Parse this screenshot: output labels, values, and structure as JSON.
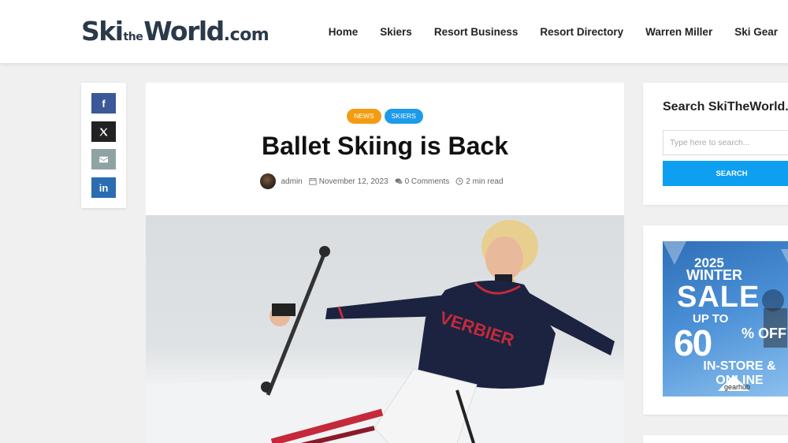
{
  "logo": {
    "part1": "Ski",
    "part2": "the",
    "part3": "World",
    "part4": ".com"
  },
  "nav": [
    "Home",
    "Skiers",
    "Resort Business",
    "Resort Directory",
    "Warren Miller",
    "Ski Gear"
  ],
  "share": [
    {
      "name": "facebook",
      "glyph": "f",
      "color": "#3b5998"
    },
    {
      "name": "x",
      "glyph": "𝕏",
      "color": "#222222"
    },
    {
      "name": "email",
      "glyph": "✉",
      "color": "#8fa3a3"
    },
    {
      "name": "linkedin",
      "glyph": "in",
      "color": "#2a6db0"
    }
  ],
  "article": {
    "categories": [
      {
        "label": "NEWS",
        "color": "#f39c12"
      },
      {
        "label": "SKIERS",
        "color": "#1e9be8"
      }
    ],
    "title": "Ballet Skiing is Back",
    "author": "admin",
    "date": "November 12, 2023",
    "comments": "0 Comments",
    "read_time": "2 min read"
  },
  "sidebar": {
    "search_title": "Search SkiTheWorld.c",
    "search_placeholder": "Type here to search...",
    "search_button": "SEARCH",
    "ad": {
      "line1": "2025",
      "line2": "WINTER",
      "line3": "SALE",
      "line4": "UP TO",
      "line5": "60",
      "line6": "% OFF",
      "line7": "IN-STORE & ONLINE",
      "brand": "gearhub"
    }
  }
}
